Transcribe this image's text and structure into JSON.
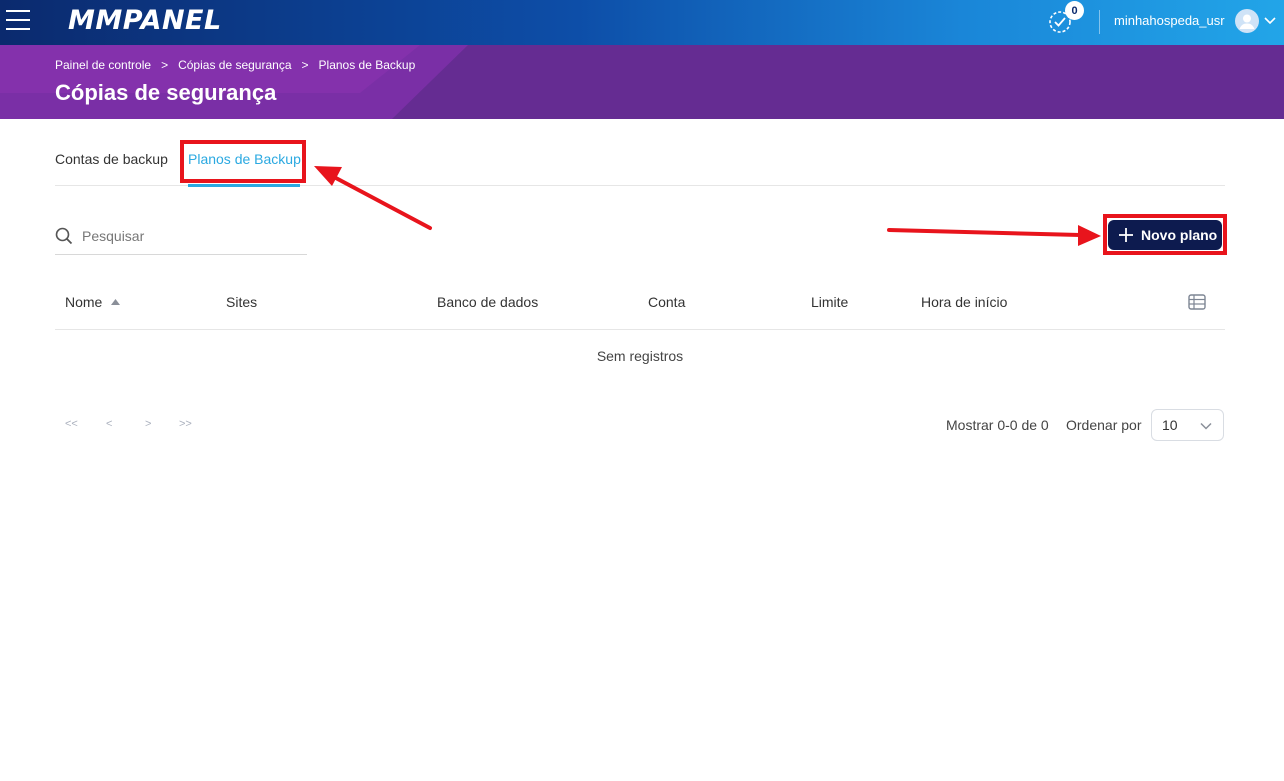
{
  "app": {
    "logo": "MMPANEL"
  },
  "topbar": {
    "tasks_count": "0",
    "username": "minhahospeda_usr"
  },
  "breadcrumb": {
    "items": [
      "Painel de controle",
      "Cópias de segurança",
      "Planos de Backup"
    ],
    "separator": ">"
  },
  "page": {
    "title": "Cópias de segurança"
  },
  "tabs": [
    {
      "label": "Contas de backup",
      "active": false
    },
    {
      "label": "Planos de Backup",
      "active": true
    }
  ],
  "search": {
    "placeholder": "Pesquisar",
    "value": ""
  },
  "actions": {
    "new_plan_label": "Novo plano"
  },
  "table": {
    "columns": [
      "Nome",
      "Sites",
      "Banco de dados",
      "Conta",
      "Limite",
      "Hora de início"
    ],
    "sorted_column": "Nome",
    "empty_text": "Sem registros"
  },
  "pagination": {
    "first": "<<",
    "prev": "<",
    "next": ">",
    "last": ">>",
    "showing": "Mostrar 0-0 de 0",
    "order_label": "Ordenar por",
    "page_size": "10"
  },
  "colors": {
    "accent": "#2ba9e1",
    "header_purple": "#652c92",
    "button_navy": "#0d1b4f",
    "annotation_red": "#e8141c"
  }
}
